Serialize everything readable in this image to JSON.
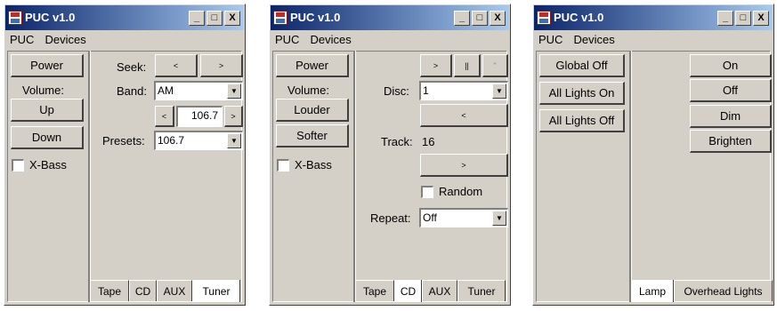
{
  "window_title": "PUC v1.0",
  "menu": [
    "PUC",
    "Devices"
  ],
  "title_buttons": {
    "minimize": "_",
    "maximize": "□",
    "close": "X"
  },
  "tuner": {
    "power": "Power",
    "volume_label": "Volume:",
    "up": "Up",
    "down": "Down",
    "xbass": "X-Bass",
    "seek_label": "Seek:",
    "seek_prev": "<",
    "seek_next": ">",
    "band_label": "Band:",
    "band_value": "AM",
    "freq_prev": "<",
    "freq_value": "106.7",
    "freq_next": ">",
    "presets_label": "Presets:",
    "presets_value": "106.7",
    "tabs": [
      "Tape",
      "CD",
      "AUX",
      "Tuner"
    ],
    "selected_tab": "Tuner"
  },
  "cd": {
    "power": "Power",
    "volume_label": "Volume:",
    "louder": "Louder",
    "softer": "Softer",
    "xbass": "X-Bass",
    "play": ">",
    "pause": "||",
    "stop": "\"",
    "disc_label": "Disc:",
    "disc_value": "1",
    "prev": "<",
    "track_label": "Track:",
    "track_value": "16",
    "next": ">",
    "random": "Random",
    "repeat_label": "Repeat:",
    "repeat_value": "Off",
    "tabs": [
      "Tape",
      "CD",
      "AUX",
      "Tuner"
    ],
    "selected_tab": "CD"
  },
  "lights": {
    "global_off": "Global Off",
    "all_on": "All Lights On",
    "all_off": "All Lights Off",
    "on": "On",
    "off": "Off",
    "dim": "Dim",
    "brighten": "Brighten",
    "tabs": [
      "Lamp",
      "Overhead Lights"
    ],
    "selected_tab": "Lamp"
  }
}
